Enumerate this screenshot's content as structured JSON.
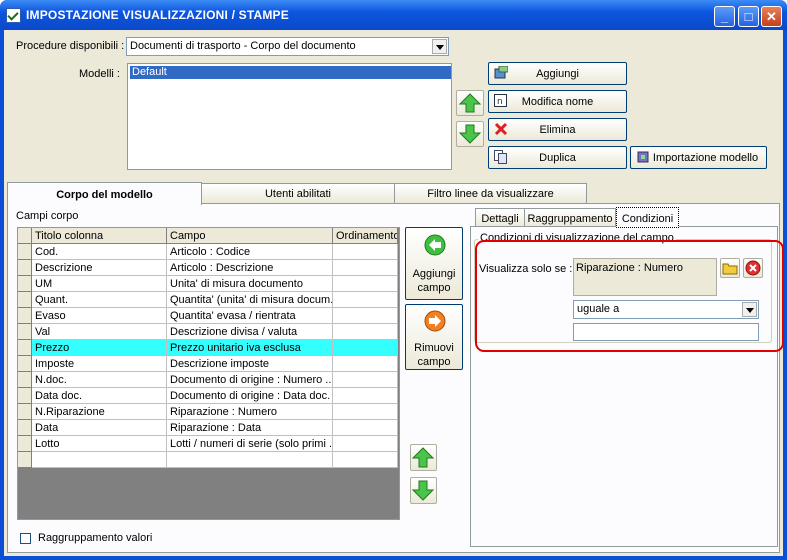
{
  "window": {
    "title": "IMPOSTAZIONE VISUALIZZAZIONI / STAMPE"
  },
  "top": {
    "procedure_label": "Procedure disponibili :",
    "procedure_value": "Documenti di trasporto - Corpo del documento",
    "modelli_label": "Modelli :",
    "modelli_items": [
      "Default"
    ]
  },
  "buttons": {
    "aggiungi": "Aggiungi",
    "modifica": "Modifica nome",
    "elimina": "Elimina",
    "duplica": "Duplica",
    "importazione": "Importazione modello"
  },
  "tabs": [
    "Corpo del modello",
    "Utenti abilitati",
    "Filtro linee da visualizzare"
  ],
  "campi": {
    "label": "Campi corpo",
    "headers": [
      "Titolo colonna",
      "Campo",
      "Ordinamento"
    ],
    "rows": [
      [
        "Cod.",
        "Articolo : Codice",
        ""
      ],
      [
        "Descrizione",
        "Articolo : Descrizione",
        ""
      ],
      [
        "UM",
        "Unita' di misura documento",
        ""
      ],
      [
        "Quant.",
        "Quantita' (unita' di misura docum...",
        ""
      ],
      [
        "Evaso",
        "Quantita' evasa / rientrata",
        ""
      ],
      [
        "Val",
        "Descrizione divisa / valuta",
        ""
      ],
      [
        "Prezzo",
        "Prezzo unitario iva esclusa",
        ""
      ],
      [
        "Imposte",
        "Descrizione imposte",
        ""
      ],
      [
        "N.doc.",
        "Documento di origine : Numero ...",
        ""
      ],
      [
        "Data doc.",
        "Documento di origine : Data doc.",
        ""
      ],
      [
        "N.Riparazione",
        "Riparazione : Numero",
        ""
      ],
      [
        "Data",
        "Riparazione : Data",
        ""
      ],
      [
        "Lotto",
        "Lotti / numeri di serie (solo primi ...",
        ""
      ],
      [
        "",
        "",
        ""
      ]
    ],
    "selected_index": 6,
    "aggiungi_line1": "Aggiungi",
    "aggiungi_line2": "campo",
    "rimuovi_line1": "Rimuovi",
    "rimuovi_line2": "campo",
    "raggruppamento": "Raggruppamento valori"
  },
  "subtabs": [
    "Dettagli",
    "Raggruppamento",
    "Condizioni"
  ],
  "condizioni": {
    "group_title": "Condizioni di visualizzazione del campo",
    "visualizza_label": "Visualizza solo se :",
    "field_value": "Riparazione : Numero",
    "operator": "uguale a",
    "value": ""
  },
  "colors": {
    "title_blue": "#0a4fd6",
    "selected_row": "#33ffff",
    "highlight_red": "#e00000",
    "face": "#ece9d8"
  }
}
